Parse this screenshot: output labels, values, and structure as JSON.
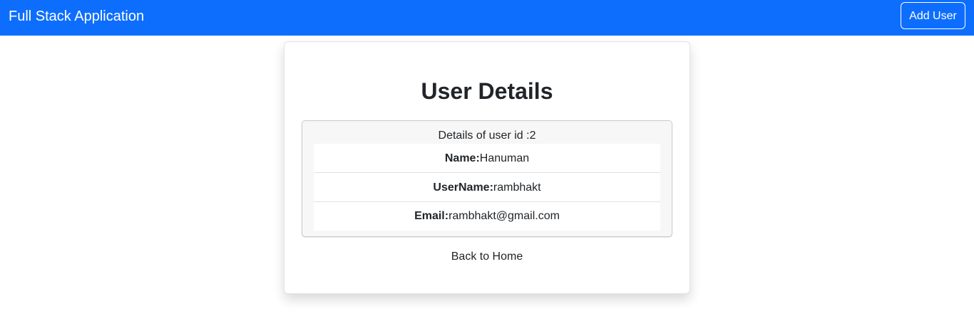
{
  "navbar": {
    "brand": "Full Stack Application",
    "add_user_label": "Add User"
  },
  "card": {
    "title": "User Details",
    "details_header": "Details of user id :2",
    "fields": [
      {
        "label": "Name:",
        "value": "Hanuman"
      },
      {
        "label": "UserName:",
        "value": "rambhakt"
      },
      {
        "label": "Email:",
        "value": "rambhakt@gmail.com"
      }
    ],
    "back_label": "Back to Home"
  },
  "colors": {
    "navbar": "#0d6efd",
    "text": "#212529"
  }
}
